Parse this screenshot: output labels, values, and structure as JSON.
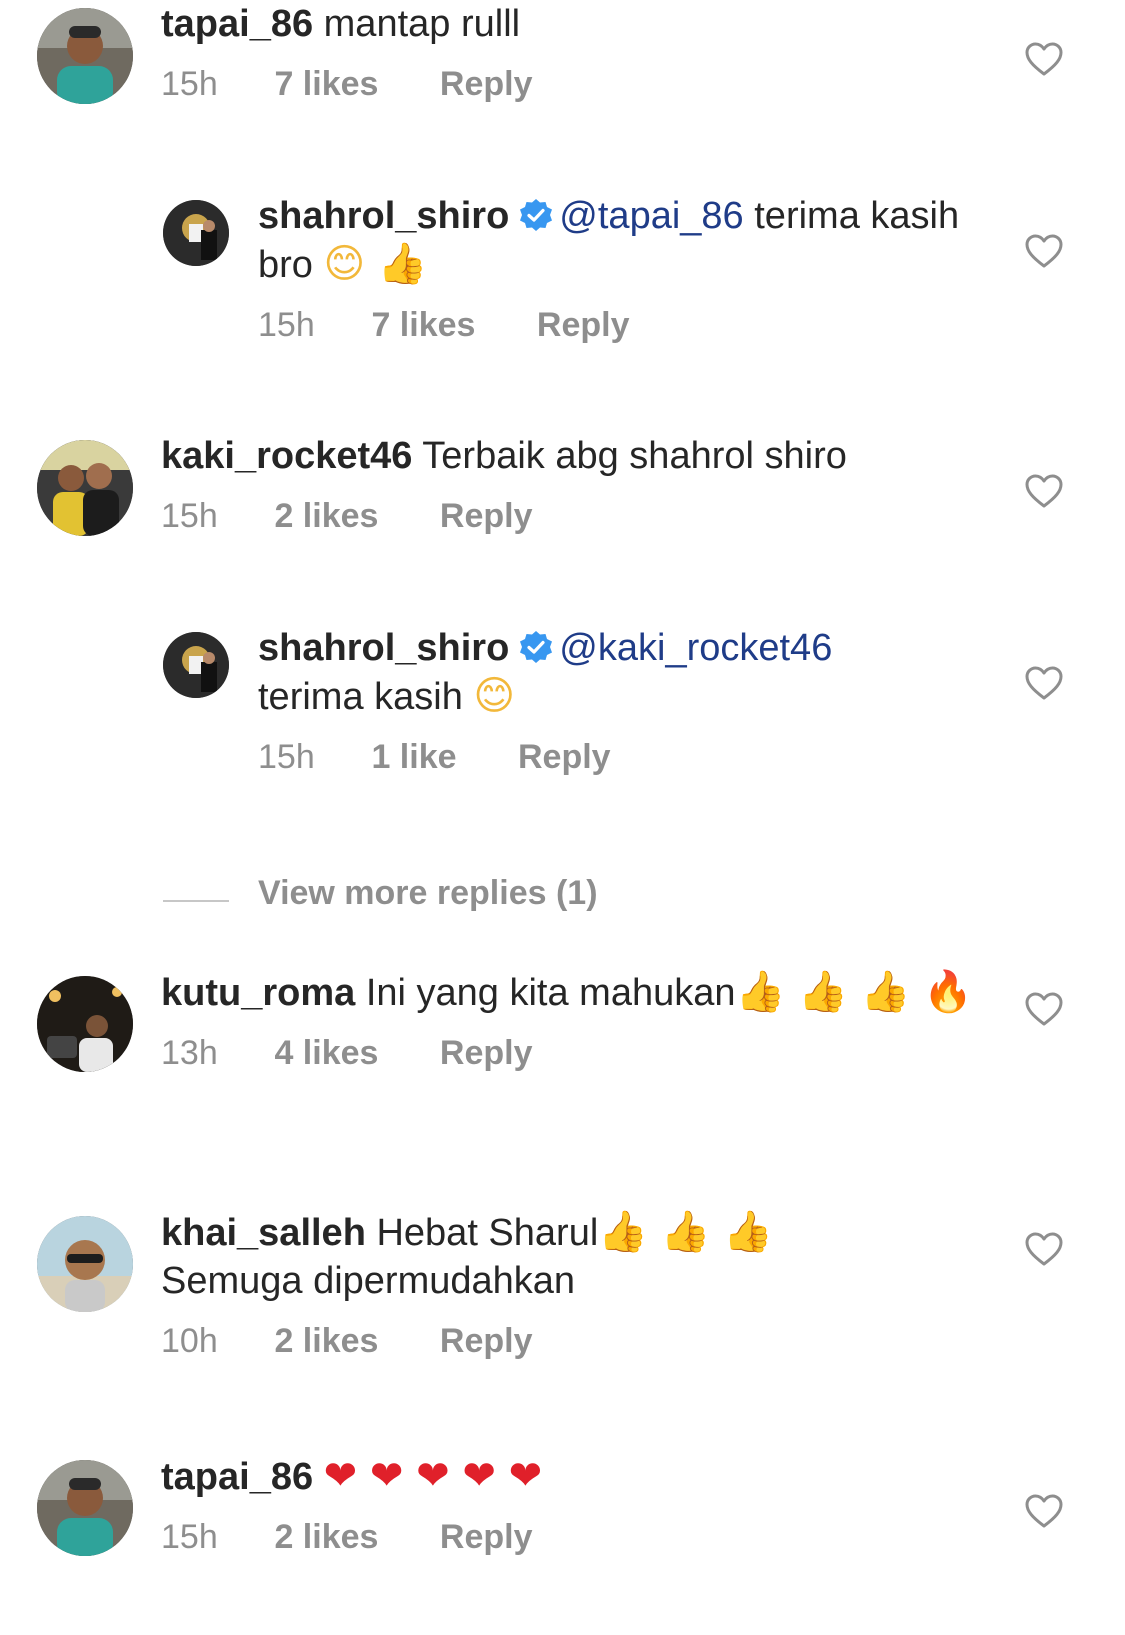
{
  "comments": [
    {
      "username": "tapai_86",
      "text": "mantap rulll",
      "emojis": "",
      "time": "15h",
      "likes": "7 likes",
      "reply": "Reply"
    },
    {
      "username": "shahrol_shiro",
      "verified": true,
      "mention": "@tapai_86",
      "text": "terima kasih bro",
      "emojis": "😊 👍",
      "time": "15h",
      "likes": "7 likes",
      "reply": "Reply"
    },
    {
      "username": "kaki_rocket46",
      "text": "Terbaik abg shahrol shiro",
      "emojis": "",
      "time": "15h",
      "likes": "2 likes",
      "reply": "Reply"
    },
    {
      "username": "shahrol_shiro",
      "verified": true,
      "mention": "@kaki_rocket46",
      "text": "terima kasih",
      "emojis": "😊",
      "time": "15h",
      "likes": "1 like",
      "reply": "Reply"
    },
    {
      "username": "kutu_roma",
      "text": "Ini yang kita mahukan",
      "emojis": "👍 👍 👍 🔥",
      "time": "13h",
      "likes": "4 likes",
      "reply": "Reply"
    },
    {
      "username": "khai_salleh",
      "text": "Hebat Sharul",
      "emojis": "👍 👍 👍",
      "text2": "Semuga dipermudahkan",
      "time": "10h",
      "likes": "2 likes",
      "reply": "Reply"
    },
    {
      "username": "tapai_86",
      "text": "",
      "emojis": "❤ ❤ ❤ ❤ ❤",
      "time": "15h",
      "likes": "2 likes",
      "reply": "Reply"
    }
  ],
  "view_more": {
    "label": "View more replies (1)"
  },
  "colors": {
    "text": "#262626",
    "meta": "#8e8e8e",
    "mention": "#1f3c88",
    "verified": "#3897f0",
    "heart_outline": "#8e8e8e"
  },
  "icons": {
    "like": "heart-outline-icon",
    "verified": "verified-badge-icon"
  }
}
